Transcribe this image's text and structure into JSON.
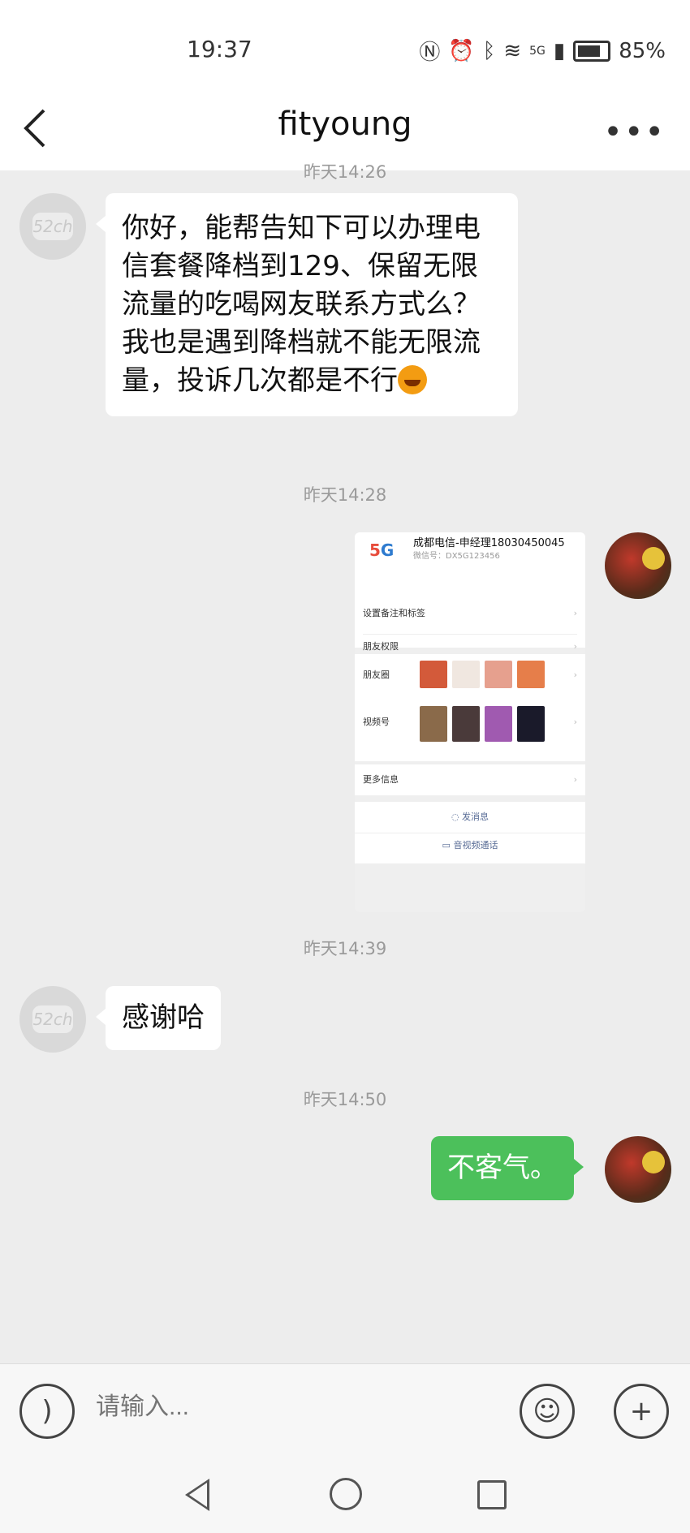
{
  "status_bar": {
    "time": "19:37",
    "network": "5G",
    "battery": "85%"
  },
  "header": {
    "title": "fityoung"
  },
  "messages": {
    "ts1": "昨天14:26",
    "msg1": "你好，能帮告知下可以办理电信套餐降档到129、保留无限流量的吃喝网友联系方式么？我也是遇到降档就不能无限流量，投诉几次都是不行",
    "ts2": "昨天14:28",
    "ts3": "昨天14:39",
    "msg3": "感谢哈",
    "ts4": "昨天14:50",
    "msg4": "不客气。"
  },
  "shared_card": {
    "name": "成都电信-申经理18030450045",
    "wechat_id": "微信号：DX5G123456",
    "rows": {
      "remarks": "设置备注和标签",
      "permissions": "朋友权限",
      "moments": "朋友圈",
      "channels": "视频号",
      "more": "更多信息",
      "send_message": "发消息",
      "video_call": "音视频通话"
    }
  },
  "input_bar": {
    "placeholder": "请输入..."
  },
  "colors": {
    "sent_bubble": "#4cc05b",
    "background": "#ededed"
  }
}
